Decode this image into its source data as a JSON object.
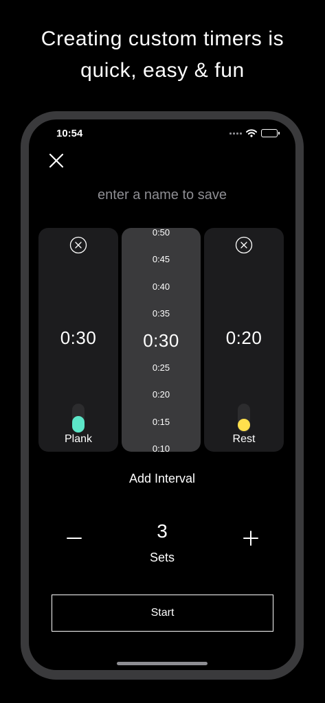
{
  "headline": {
    "line1": "Creating custom timers is",
    "line2": "quick, easy & fun"
  },
  "status_bar": {
    "time": "10:54",
    "icons": [
      "cellular-signal-icon",
      "wifi-icon",
      "battery-icon"
    ]
  },
  "timer_editor": {
    "close_icon": "close-icon",
    "name_placeholder": "enter a name to save",
    "name_value": "",
    "intervals": [
      {
        "time": "0:30",
        "label": "Plank",
        "color": "#5ce6c8",
        "remove_icon": "circle-x-icon"
      },
      {
        "time": "0:20",
        "label": "Rest",
        "color": "#ffe04d",
        "remove_icon": "circle-x-icon"
      }
    ],
    "picker": {
      "options": [
        "0:50",
        "0:45",
        "0:40",
        "0:35",
        "0:30",
        "0:25",
        "0:20",
        "0:15",
        "0:10"
      ],
      "selected": "0:30"
    },
    "add_interval_label": "Add Interval",
    "sets": {
      "count": "3",
      "label": "Sets",
      "decrement_icon": "minus-icon",
      "increment_icon": "plus-icon"
    },
    "start_label": "Start"
  },
  "colors": {
    "background": "#000000",
    "frame": "#3a3a3c",
    "card": "#1c1c1e",
    "picker": "#3a3a3c",
    "muted_text": "#8e8e93"
  }
}
